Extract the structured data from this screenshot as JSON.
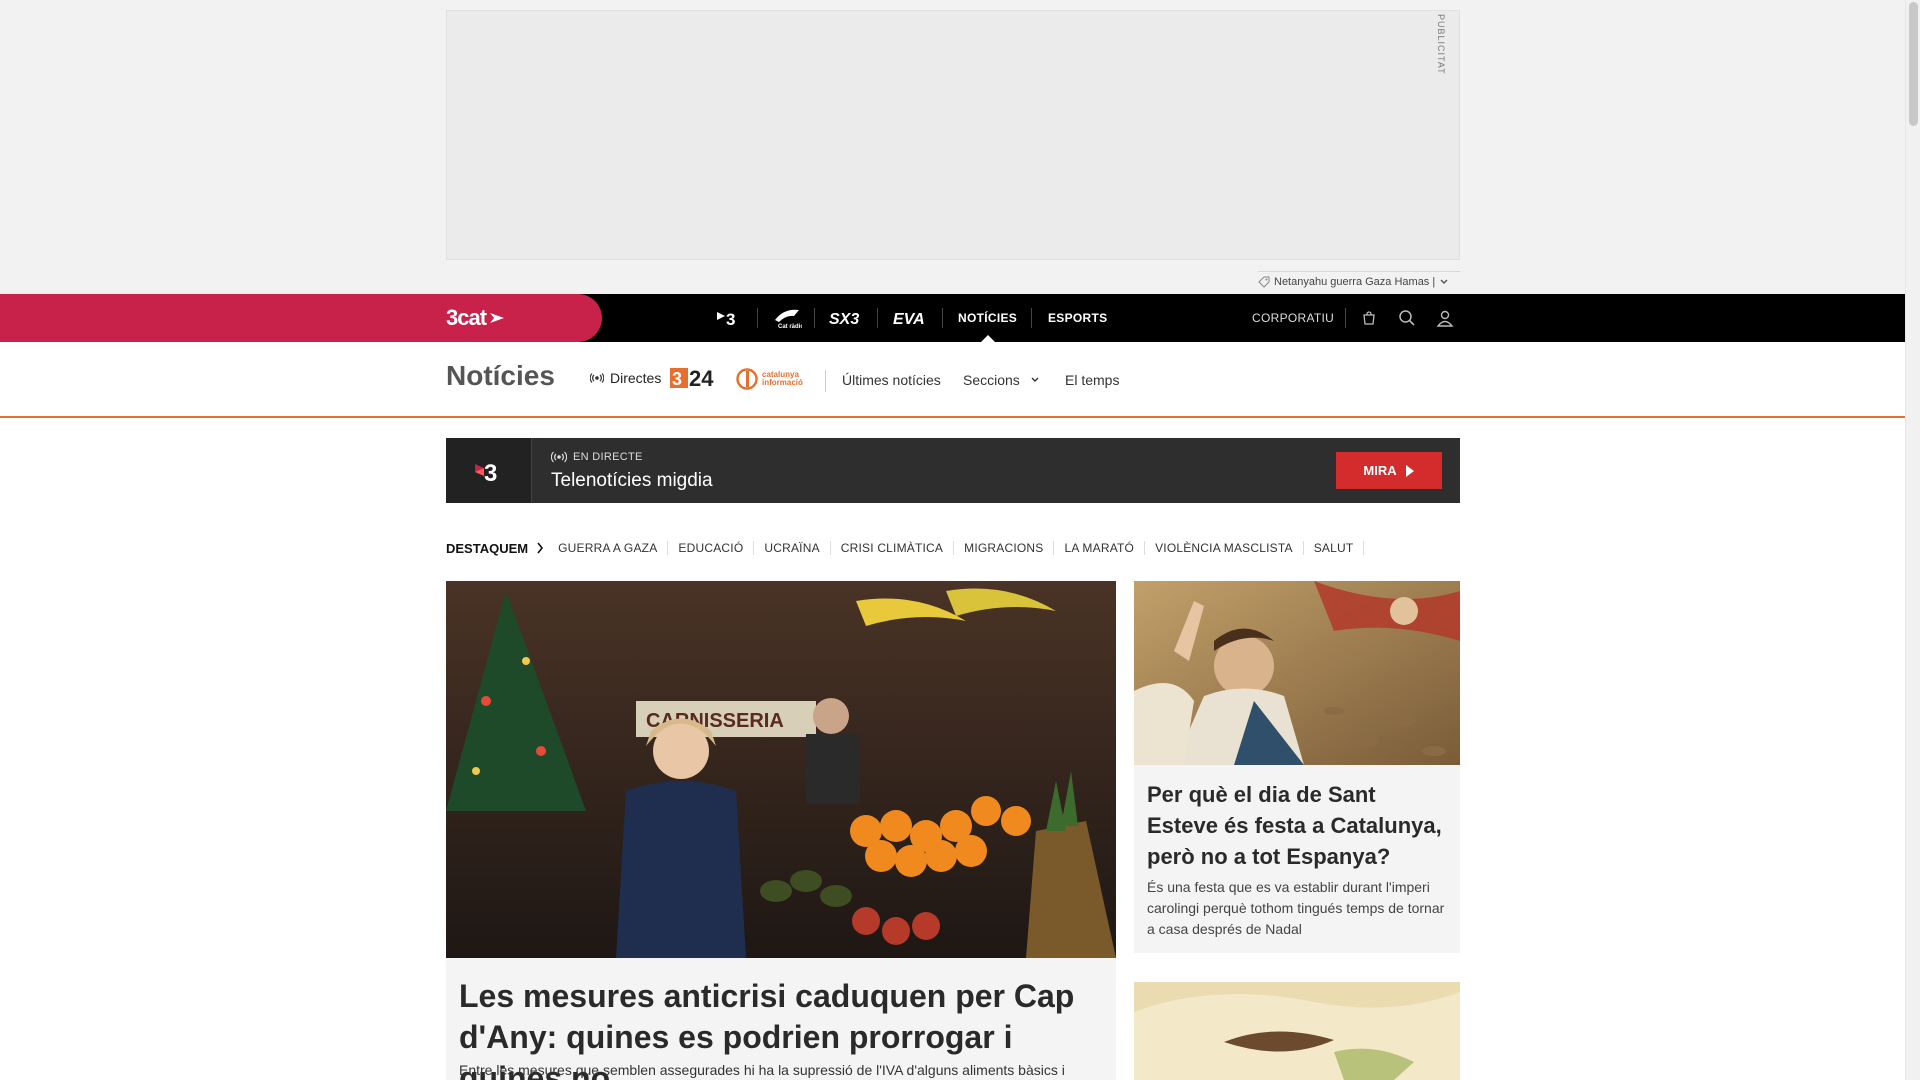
{
  "ad": {
    "label": "PUBLICITAT",
    "tags_text": "Netanyahu guerra Gaza Hamas |"
  },
  "topnav": {
    "brand": "3cat",
    "channels": [
      {
        "name": "tv3-logo",
        "label": "3"
      },
      {
        "name": "catradio-logo",
        "label": "Cat ràdio"
      },
      {
        "name": "sx3-logo",
        "label": "SX3"
      },
      {
        "name": "eva-logo",
        "label": "EVA"
      }
    ],
    "links": {
      "noticies": "NOTÍCIES",
      "esports": "ESPORTS"
    },
    "corporatiu": "CORPORATIU"
  },
  "section": {
    "title": "Notícies",
    "directes": "Directes",
    "logo324": "324",
    "logocat": "catalunya informació",
    "links": [
      "Últimes notícies",
      "Seccions",
      "El temps"
    ]
  },
  "live": {
    "tag": "EN DIRECTE",
    "title": "Telenotícies migdia",
    "button": "MIRA"
  },
  "featured": {
    "label": "DESTAQUEM",
    "tags": [
      "GUERRA A GAZA",
      "EDUCACIÓ",
      "UCRAÏNA",
      "CRISI CLIMÀTICA",
      "MIGRACIONS",
      "LA MARATÓ",
      "VIOLÈNCIA MASCLISTA",
      "SALUT"
    ]
  },
  "main_article": {
    "image_text": "CARNISSERIA",
    "title": "Les mesures anticrisi caduquen per Cap d'Any: quines es podrien prorrogar i quines no",
    "excerpt": "Entre les mesures que semblen assegurades hi ha la supressió de l'IVA d'alguns aliments bàsics i"
  },
  "side_article": {
    "title": "Per què el dia de Sant Esteve és festa a Catalunya, però no a tot Espanya?",
    "excerpt": "És una festa que es va establir durant l'imperi carolingi perquè tothom tingués temps de tornar a casa després de Nadal"
  },
  "colors": {
    "brand": "#c8214a",
    "accent": "#e76f2d",
    "live_button": "#d42c2c"
  }
}
